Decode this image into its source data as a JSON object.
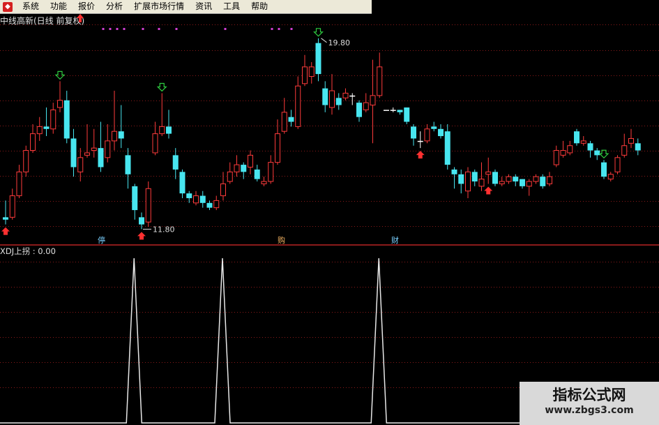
{
  "menu": {
    "items": [
      "系统",
      "功能",
      "报价",
      "分析",
      "扩展市场行情",
      "资讯",
      "工具",
      "帮助"
    ]
  },
  "chart": {
    "title": "中线高新(日线 前复权)",
    "high_label": "19.80",
    "low_label": "11.80",
    "bottom_markers": [
      "停",
      "购",
      "财"
    ],
    "colors": {
      "up": "#ff3b3b",
      "down": "#48e6f0",
      "flat": "#ffffff",
      "grid": "#8b1a1a",
      "signal_down": "#2ecc40",
      "signal_up": "#ff3030",
      "dots": "#d040d0"
    }
  },
  "chart_data": [
    {
      "type": "candlestick",
      "title": "中线高新(日线 前复权)",
      "ylim": [
        11,
        21
      ],
      "high": 19.8,
      "low": 11.8,
      "candles": [
        [
          12.3,
          12.2,
          13.0,
          12.0
        ],
        [
          12.3,
          13.2,
          13.5,
          12.2
        ],
        [
          13.2,
          14.2,
          14.5,
          13.1
        ],
        [
          14.2,
          15.1,
          15.3,
          14.0
        ],
        [
          15.1,
          15.8,
          16.2,
          15.0
        ],
        [
          15.8,
          16.1,
          16.5,
          15.5
        ],
        [
          16.1,
          16.0,
          16.9,
          15.7
        ],
        [
          16.0,
          16.8,
          17.1,
          15.8
        ],
        [
          16.9,
          17.2,
          18.0,
          16.7
        ],
        [
          17.2,
          15.6,
          17.6,
          15.4
        ],
        [
          15.6,
          14.4,
          16.0,
          14.0
        ],
        [
          14.2,
          14.8,
          15.2,
          13.8
        ],
        [
          14.9,
          15.0,
          16.2,
          14.8
        ],
        [
          15.1,
          15.2,
          16.0,
          14.8
        ],
        [
          15.2,
          14.4,
          16.3,
          14.2
        ],
        [
          14.8,
          15.5,
          16.2,
          14.6
        ],
        [
          15.5,
          15.9,
          17.6,
          15.1
        ],
        [
          15.9,
          15.6,
          17.0,
          15.2
        ],
        [
          14.9,
          14.1,
          15.2,
          13.5
        ],
        [
          13.6,
          12.6,
          13.7,
          12.2
        ],
        [
          12.3,
          12.0,
          12.5,
          11.8
        ],
        [
          12.1,
          13.5,
          13.8,
          11.9
        ],
        [
          15.0,
          15.8,
          16.3,
          14.9
        ],
        [
          15.8,
          16.1,
          17.5,
          15.7
        ],
        [
          16.1,
          15.8,
          16.8,
          15.6
        ],
        [
          14.9,
          14.3,
          15.2,
          13.9
        ],
        [
          14.2,
          13.3,
          14.3,
          13.1
        ],
        [
          13.3,
          13.1,
          13.4,
          12.9
        ],
        [
          12.9,
          13.2,
          13.4,
          12.8
        ],
        [
          13.2,
          12.9,
          13.4,
          12.7
        ],
        [
          12.9,
          12.7,
          13.0,
          12.6
        ],
        [
          12.7,
          13.0,
          13.2,
          12.6
        ],
        [
          13.2,
          13.7,
          14.2,
          13.0
        ],
        [
          13.8,
          14.2,
          14.6,
          13.7
        ],
        [
          14.2,
          14.5,
          14.9,
          14.0
        ],
        [
          14.5,
          14.2,
          14.6,
          13.9
        ],
        [
          14.4,
          14.9,
          15.1,
          14.1
        ],
        [
          14.3,
          13.9,
          14.5,
          13.8
        ],
        [
          13.7,
          13.8,
          14.0,
          13.6
        ],
        [
          13.8,
          14.6,
          14.9,
          13.7
        ],
        [
          14.6,
          15.8,
          16.4,
          14.5
        ],
        [
          15.9,
          16.7,
          17.3,
          15.8
        ],
        [
          16.5,
          16.3,
          16.8,
          16.1
        ],
        [
          16.1,
          17.8,
          18.2,
          16.0
        ],
        [
          17.9,
          18.6,
          19.1,
          17.8
        ],
        [
          18.2,
          18.6,
          18.8,
          17.9
        ],
        [
          19.6,
          18.3,
          19.8,
          18.0
        ],
        [
          17.7,
          17.0,
          18.0,
          16.7
        ],
        [
          16.9,
          17.6,
          18.3,
          16.6
        ],
        [
          17.3,
          17.0,
          17.5,
          16.8
        ],
        [
          17.3,
          17.5,
          17.7,
          17.2
        ],
        [
          17.4,
          17.4,
          17.5,
          17.0
        ],
        [
          17.1,
          16.5,
          17.2,
          16.3
        ],
        [
          16.8,
          17.1,
          17.5,
          16.7
        ],
        [
          17.0,
          17.4,
          18.9,
          15.4
        ],
        [
          17.4,
          18.6,
          19.2,
          17.3
        ],
        [
          16.8,
          16.8,
          16.8,
          16.8
        ],
        [
          16.8,
          16.8,
          16.9,
          16.7
        ],
        [
          16.8,
          16.7,
          16.8,
          16.6
        ],
        [
          16.9,
          16.3,
          16.9,
          16.2
        ],
        [
          16.1,
          15.6,
          16.2,
          15.3
        ],
        [
          15.5,
          15.5,
          15.9,
          15.2
        ],
        [
          15.5,
          16.0,
          16.2,
          15.4
        ],
        [
          16.1,
          16.0,
          16.3,
          15.9
        ],
        [
          16.0,
          15.7,
          16.2,
          15.6
        ],
        [
          15.9,
          14.5,
          16.2,
          14.3
        ],
        [
          14.3,
          14.1,
          14.4,
          13.5
        ],
        [
          14.1,
          13.7,
          14.3,
          13.3
        ],
        [
          13.4,
          14.2,
          14.4,
          13.1
        ],
        [
          14.2,
          13.8,
          14.3,
          13.6
        ],
        [
          13.6,
          13.9,
          14.6,
          13.4
        ],
        [
          14.1,
          14.2,
          14.8,
          13.7
        ],
        [
          14.2,
          13.7,
          14.3,
          13.6
        ],
        [
          13.7,
          13.8,
          14.0,
          13.6
        ],
        [
          13.8,
          14.0,
          14.1,
          13.7
        ],
        [
          14.0,
          13.8,
          14.1,
          13.6
        ],
        [
          13.9,
          13.6,
          13.9,
          13.5
        ],
        [
          13.6,
          13.8,
          13.9,
          13.2
        ],
        [
          13.8,
          14.0,
          14.1,
          13.7
        ],
        [
          14.0,
          13.6,
          14.1,
          13.5
        ],
        [
          13.7,
          14.0,
          14.2,
          13.6
        ],
        [
          14.5,
          15.1,
          15.3,
          14.4
        ],
        [
          14.9,
          15.1,
          15.5,
          14.8
        ],
        [
          15.0,
          15.3,
          15.5,
          14.9
        ],
        [
          15.9,
          15.4,
          16.0,
          15.3
        ],
        [
          15.4,
          15.5,
          15.7,
          15.3
        ],
        [
          15.4,
          15.1,
          15.5,
          14.8
        ],
        [
          15.1,
          14.9,
          15.2,
          14.7
        ],
        [
          14.6,
          14.0,
          14.7,
          13.9
        ],
        [
          13.9,
          14.1,
          14.2,
          13.8
        ],
        [
          14.2,
          14.8,
          14.9,
          14.1
        ],
        [
          14.9,
          15.3,
          15.8,
          14.8
        ],
        [
          15.4,
          15.6,
          16.0,
          15.2
        ],
        [
          15.4,
          15.1,
          15.6,
          14.9
        ]
      ],
      "signals": {
        "down_arrows": [
          8,
          23,
          46,
          88
        ],
        "up_arrows": [
          0,
          20,
          61,
          71
        ]
      }
    },
    {
      "type": "line",
      "title": "XDJ上拐",
      "series": [
        {
          "name": "XDJ上拐",
          "value": 0.0,
          "peaks_at": [
            19,
            32,
            55
          ]
        }
      ],
      "ylim": [
        0,
        1
      ]
    }
  ],
  "oscillator": {
    "label": "XDJ上拐 : 0.00"
  },
  "watermark": {
    "title": "指标公式网",
    "url": "www.zbgs3.com"
  }
}
